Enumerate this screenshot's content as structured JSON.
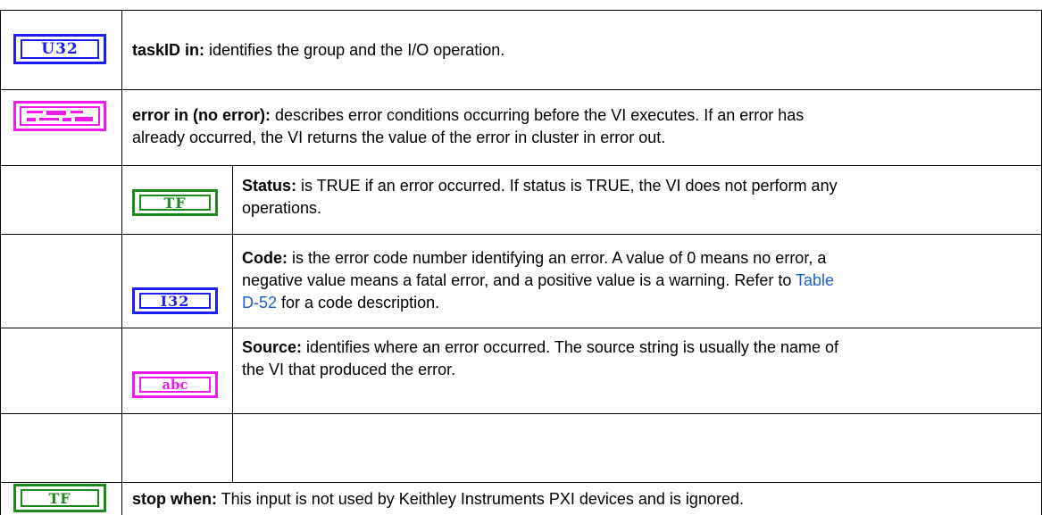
{
  "rows": {
    "taskid": {
      "icon_label": "U32",
      "icon": "u32-terminal-icon",
      "term": "taskID in:",
      "desc": " identifies the group and the I/O operation."
    },
    "error_in": {
      "icon": "error-cluster-icon",
      "term": "error in (no error):",
      "line1": " describes error conditions occurring before the VI executes. If an error has",
      "line2": "already occurred, the VI returns the value of the error in cluster in error out."
    },
    "status": {
      "icon_label": "TF",
      "icon": "boolean-tf-icon",
      "term": "Status:",
      "line1": " is TRUE if an error occurred.  If status is TRUE, the VI does not perform any",
      "line2": "operations."
    },
    "code": {
      "icon_label": "I32",
      "icon": "i32-terminal-icon",
      "term": "Code:",
      "line1": " is the error code number identifying an error.  A value of 0 means no error, a",
      "line2_pre": "negative value means a fatal error, and a positive value is a warning. Refer to ",
      "link_part1": "Table",
      "link_part2": "D-52",
      "line3_post": " for a code description."
    },
    "source": {
      "icon_label": "abc",
      "icon": "string-abc-icon",
      "term": "Source:",
      "line1": " identifies where an error occurred.  The source string is usually the name of",
      "line2": "the VI that produced the error."
    },
    "stop_when": {
      "icon_label": "TF",
      "icon": "boolean-tf-icon",
      "term": "stop when:",
      "desc": " This input is not used by Keithley Instruments PXI devices and is ignored."
    }
  },
  "colors": {
    "numeric_blue": "#1c1cf5",
    "boolean_green": "#1c8a1c",
    "string_pink": "#ee1bee",
    "link_blue": "#1a5fd6"
  }
}
